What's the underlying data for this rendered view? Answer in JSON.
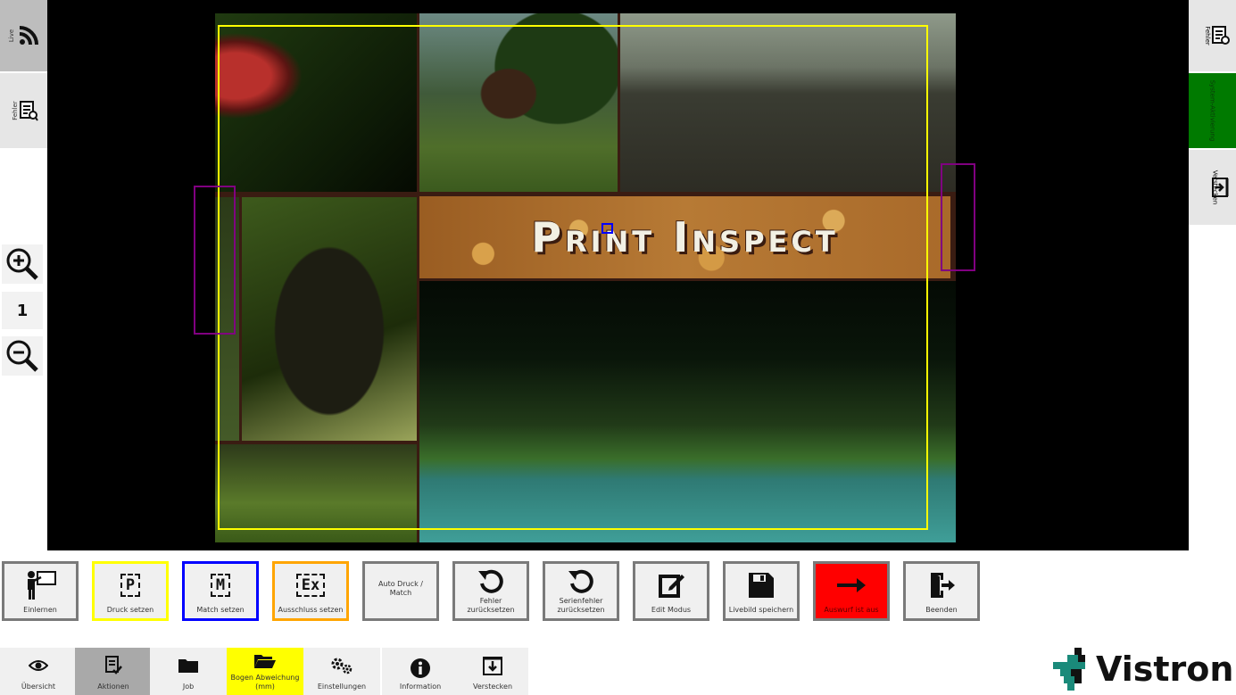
{
  "left_sidebar": {
    "live_tab": {
      "label": "Live",
      "icon": "rss-feed-icon"
    },
    "fehler_tab": {
      "label": "Fehler",
      "icon": "error-report-icon"
    },
    "zoom_in_icon": "zoom-in-icon",
    "zoom_level": "1",
    "zoom_out_icon": "zoom-out-icon"
  },
  "viewport": {
    "banner_text": "Print Inspect",
    "roi_colors": {
      "print_area": "#ffff00",
      "match": "#0000ff",
      "exclusion": "#800080"
    }
  },
  "right_sidebar": {
    "fehler": {
      "label": "Fehler",
      "icon": "error-report-icon"
    },
    "system_status": {
      "label": "System-Aktivierung",
      "color": "#007a00"
    },
    "verstecken": {
      "label": "Verstecken",
      "icon": "hide-panel-icon"
    }
  },
  "actions": [
    {
      "id": "einlernen",
      "label": "Einlernen",
      "icon": "teacher-icon",
      "border": "#7a7a7a",
      "bg": "#f0f0f0"
    },
    {
      "id": "druck",
      "label": "Druck setzen",
      "mark": "P",
      "border": "#ffff00",
      "bg": "#f0f0f0"
    },
    {
      "id": "match",
      "label": "Match setzen",
      "mark": "M",
      "border": "#0000ff",
      "bg": "#f0f0f0"
    },
    {
      "id": "ausschluss",
      "label": "Ausschluss setzen",
      "mark": "Ex",
      "border": "#ffa500",
      "bg": "#f0f0f0"
    },
    {
      "id": "auto",
      "label": "Auto Druck / Match",
      "border": "#7a7a7a",
      "bg": "#f0f0f0"
    },
    {
      "id": "fehler_reset",
      "label": "Fehler zurücksetzen",
      "icon": "reset-icon",
      "border": "#7a7a7a",
      "bg": "#f0f0f0"
    },
    {
      "id": "serien_reset",
      "label": "Serienfehler zurücksetzen",
      "icon": "reset-icon",
      "border": "#7a7a7a",
      "bg": "#f0f0f0"
    },
    {
      "id": "edit",
      "label": "Edit Modus",
      "icon": "edit-icon",
      "border": "#7a7a7a",
      "bg": "#f0f0f0"
    },
    {
      "id": "save",
      "label": "Livebild speichern",
      "icon": "save-icon",
      "border": "#7a7a7a",
      "bg": "#f0f0f0"
    },
    {
      "id": "auswurf",
      "label": "Auswurf ist aus",
      "icon": "arrow-right-icon",
      "border": "#7a7a7a",
      "bg": "#ff0000"
    },
    {
      "id": "beenden",
      "label": "Beenden",
      "icon": "exit-icon",
      "border": "#7a7a7a",
      "bg": "#f0f0f0"
    }
  ],
  "nav": [
    {
      "id": "uebersicht",
      "label": "Übersicht",
      "icon": "eye-icon",
      "bg": "#f0f0f0"
    },
    {
      "id": "aktionen",
      "label": "Aktionen",
      "icon": "checklist-icon",
      "bg": "#a9a9a9"
    },
    {
      "id": "job",
      "label": "Job",
      "icon": "folder-icon",
      "bg": "#f0f0f0"
    },
    {
      "id": "bogen",
      "label": "Bogen Abweichung (mm)",
      "icon": "folder-open-icon",
      "bg": "#ffff00"
    },
    {
      "id": "einstellungen",
      "label": "Einstellungen",
      "icon": "gears-icon",
      "bg": "#f0f0f0"
    },
    {
      "id": "information",
      "label": "Information",
      "icon": "info-icon",
      "bg": "#f0f0f0"
    },
    {
      "id": "verstecken",
      "label": "Verstecken",
      "icon": "hide-panel-icon",
      "bg": "#f0f0f0"
    }
  ],
  "logo": {
    "text": "Vistron",
    "accent": "#1a8a7a"
  }
}
